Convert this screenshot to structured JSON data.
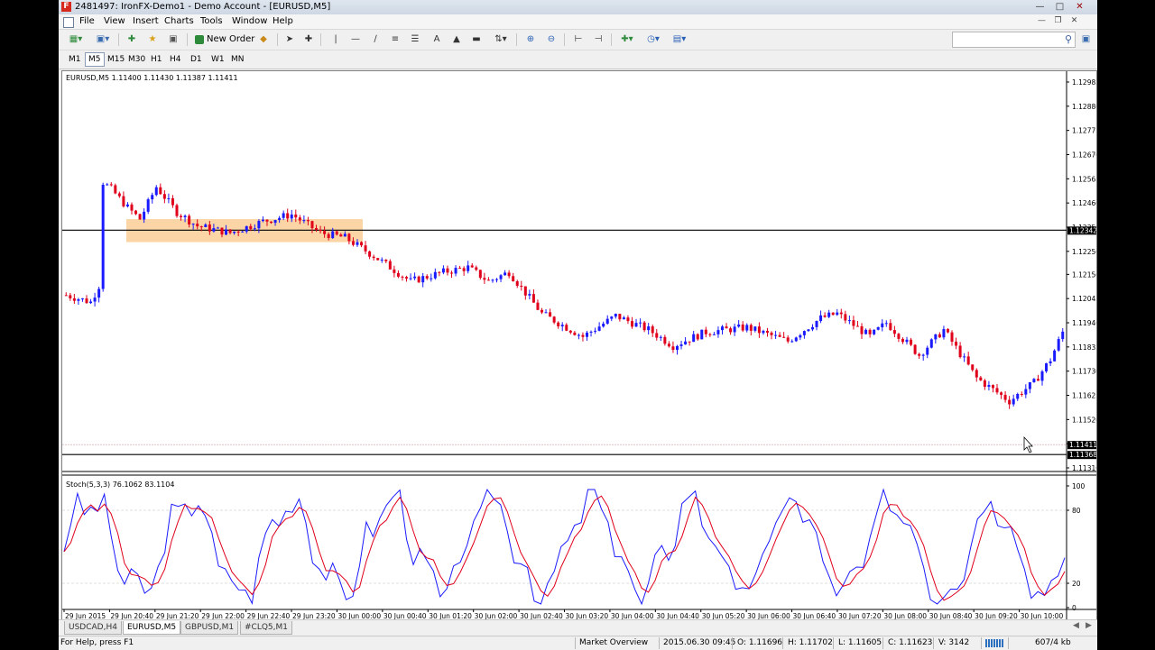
{
  "window": {
    "title": "2481497: IronFX-Demo1 - Demo Account - [EURUSD,M5]",
    "app_icon": "F"
  },
  "menu": [
    "File",
    "View",
    "Insert",
    "Charts",
    "Tools",
    "Window",
    "Help"
  ],
  "toolbar": {
    "new_order": "New Order"
  },
  "timeframes": [
    "M1",
    "M5",
    "M15",
    "M30",
    "H1",
    "H4",
    "D1",
    "W1",
    "MN"
  ],
  "active_timeframe": "M5",
  "chart": {
    "header": "EURUSD,M5  1.11400 1.11430 1.11387 1.11411",
    "price_axis": [
      "1.12985",
      "1.12880",
      "1.12775",
      "1.12670",
      "1.12565",
      "1.12460",
      "1.12355",
      "1.12250",
      "1.12150",
      "1.12045",
      "1.11940",
      "1.11835",
      "1.11730",
      "1.11625",
      "1.11520",
      "1.11415",
      "1.11310"
    ],
    "price_axis_values": [
      1.12985,
      1.1288,
      1.12775,
      1.1267,
      1.12565,
      1.1246,
      1.12355,
      1.1225,
      1.1215,
      1.12045,
      1.1194,
      1.11835,
      1.1173,
      1.11625,
      1.1152,
      1.11415,
      1.1131
    ],
    "hline_label": "1.12342",
    "hline_value": 1.12342,
    "bid_label": "1.11411",
    "bid_value": 1.11411,
    "low_label": "1.11368",
    "low_value": 1.11368,
    "time_axis": [
      "29 Jun 2015",
      "29 Jun 20:40",
      "29 Jun 21:20",
      "29 Jun 22:00",
      "29 Jun 22:40",
      "29 Jun 23:20",
      "30 Jun 00:00",
      "30 Jun 00:40",
      "30 Jun 01:20",
      "30 Jun 02:00",
      "30 Jun 02:40",
      "30 Jun 03:20",
      "30 Jun 04:00",
      "30 Jun 04:40",
      "30 Jun 05:20",
      "30 Jun 06:00",
      "30 Jun 06:40",
      "30 Jun 07:20",
      "30 Jun 08:00",
      "30 Jun 08:40",
      "30 Jun 09:20",
      "30 Jun 10:00"
    ],
    "up_color": "#1a1aff",
    "down_color": "#e0001b",
    "zone_color": "#fbd5a5"
  },
  "stochastic": {
    "label": "Stoch(5,3,3) 76.1062 83.1104",
    "levels": [
      "100",
      "80",
      "20",
      "0"
    ],
    "level_values": [
      100,
      80,
      20,
      0
    ],
    "main_color": "#1a1aff",
    "signal_color": "#e0001b"
  },
  "tabs": [
    "USDCAD,H4",
    "EURUSD,M5",
    "GBPUSD,M1",
    "#CLQ5,M1"
  ],
  "active_tab": "EURUSD,M5",
  "status": {
    "help": "For Help, press F1",
    "profile": "Market Overview",
    "datetime": "2015.06.30 09:45",
    "open": "O: 1.11696",
    "high": "H: 1.11702",
    "low": "L: 1.11605",
    "close": "C: 1.11623",
    "volume": "V: 3142",
    "traffic": "607/4 kb"
  }
}
